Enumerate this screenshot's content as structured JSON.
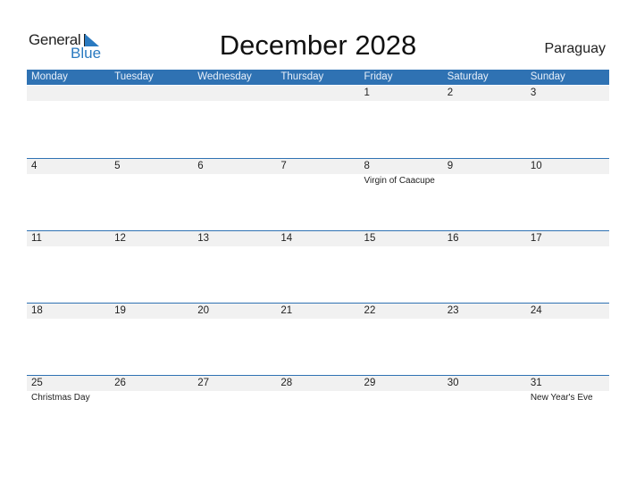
{
  "logo": {
    "part1": "General",
    "part2": "Blue",
    "accent": "#2a7ac0"
  },
  "title": "December 2028",
  "country": "Paraguay",
  "colors": {
    "header_bg": "#2f72b3",
    "band_bg": "#f1f1f1"
  },
  "weekdays": [
    "Monday",
    "Tuesday",
    "Wednesday",
    "Thursday",
    "Friday",
    "Saturday",
    "Sunday"
  ],
  "weeks": [
    [
      {
        "day": "",
        "holiday": ""
      },
      {
        "day": "",
        "holiday": ""
      },
      {
        "day": "",
        "holiday": ""
      },
      {
        "day": "",
        "holiday": ""
      },
      {
        "day": "1",
        "holiday": ""
      },
      {
        "day": "2",
        "holiday": ""
      },
      {
        "day": "3",
        "holiday": ""
      }
    ],
    [
      {
        "day": "4",
        "holiday": ""
      },
      {
        "day": "5",
        "holiday": ""
      },
      {
        "day": "6",
        "holiday": ""
      },
      {
        "day": "7",
        "holiday": ""
      },
      {
        "day": "8",
        "holiday": "Virgin of Caacupe"
      },
      {
        "day": "9",
        "holiday": ""
      },
      {
        "day": "10",
        "holiday": ""
      }
    ],
    [
      {
        "day": "11",
        "holiday": ""
      },
      {
        "day": "12",
        "holiday": ""
      },
      {
        "day": "13",
        "holiday": ""
      },
      {
        "day": "14",
        "holiday": ""
      },
      {
        "day": "15",
        "holiday": ""
      },
      {
        "day": "16",
        "holiday": ""
      },
      {
        "day": "17",
        "holiday": ""
      }
    ],
    [
      {
        "day": "18",
        "holiday": ""
      },
      {
        "day": "19",
        "holiday": ""
      },
      {
        "day": "20",
        "holiday": ""
      },
      {
        "day": "21",
        "holiday": ""
      },
      {
        "day": "22",
        "holiday": ""
      },
      {
        "day": "23",
        "holiday": ""
      },
      {
        "day": "24",
        "holiday": ""
      }
    ],
    [
      {
        "day": "25",
        "holiday": "Christmas Day"
      },
      {
        "day": "26",
        "holiday": ""
      },
      {
        "day": "27",
        "holiday": ""
      },
      {
        "day": "28",
        "holiday": ""
      },
      {
        "day": "29",
        "holiday": ""
      },
      {
        "day": "30",
        "holiday": ""
      },
      {
        "day": "31",
        "holiday": "New Year's Eve"
      }
    ]
  ]
}
